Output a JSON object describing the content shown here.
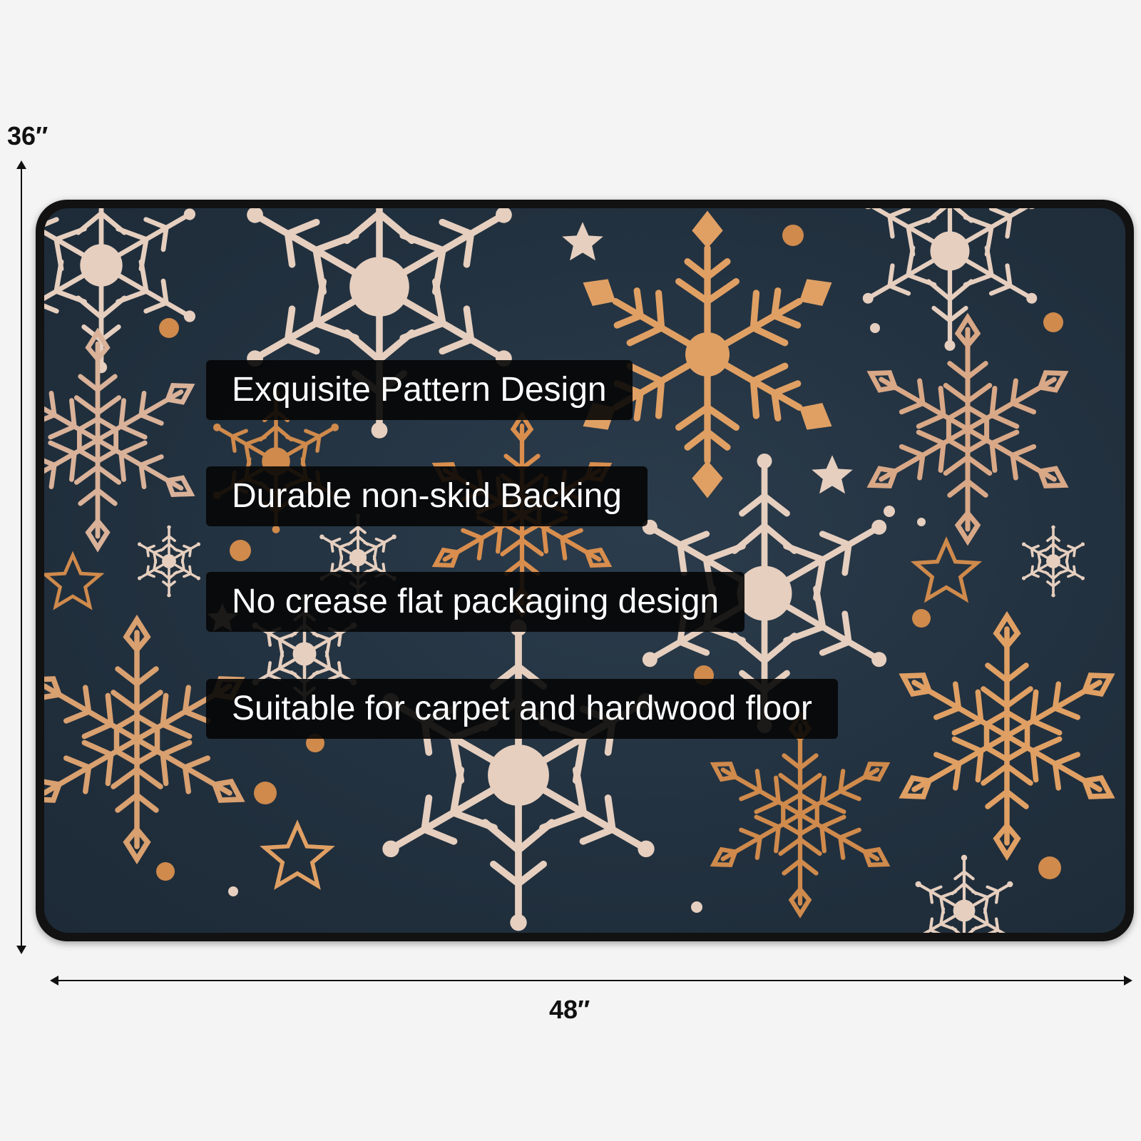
{
  "dimensions": {
    "height_label": "36″",
    "width_label": "48″"
  },
  "features": [
    "Exquisite Pattern Design",
    "Durable non-skid Backing",
    "No crease flat packaging design",
    "Suitable for carpet and hardwood floor"
  ],
  "colors": {
    "background": "#f4f4f4",
    "mat_border": "#121212",
    "mat_surface": "#22313f",
    "snowflake_cream": "#e6cfbf",
    "snowflake_gold": "#e0a064",
    "snowflake_copper": "#cf8a4c",
    "label_background": "#060606",
    "label_text": "#ffffff"
  },
  "icons": [
    "snowflake-icon",
    "star-icon",
    "dot-icon",
    "arrow-up-icon",
    "arrow-down-icon",
    "arrow-left-icon",
    "arrow-right-icon"
  ]
}
